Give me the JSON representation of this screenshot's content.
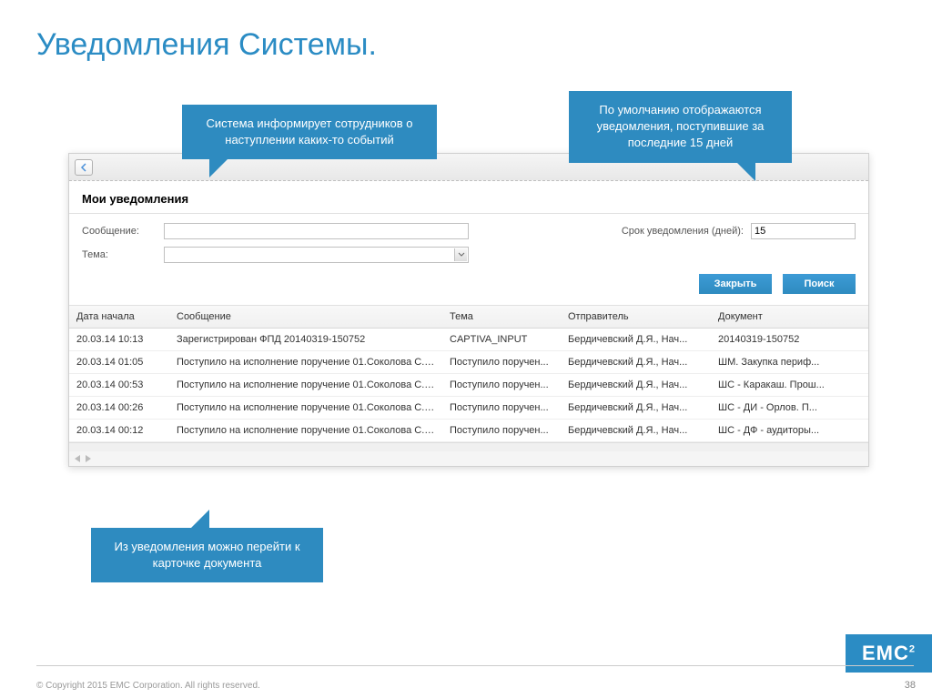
{
  "title": "Уведомления Системы.",
  "callouts": {
    "c1": "Система информирует сотрудников о наступлении каких-то событий",
    "c2": "По умолчанию отображаются уведомления, поступившие за последние 15 дней",
    "c3": "Из уведомления можно перейти к карточке документа"
  },
  "panel": {
    "section_title": "Мои уведомления",
    "filters": {
      "message_label": "Сообщение:",
      "theme_label": "Тема:",
      "period_label": "Срок уведомления (дней):",
      "period_value": "15"
    },
    "buttons": {
      "close": "Закрыть",
      "search": "Поиск"
    },
    "columns": {
      "c1": "Дата начала",
      "c2": "Сообщение",
      "c3": "Тема",
      "c4": "Отправитель",
      "c5": "Документ"
    },
    "rows": [
      {
        "date": "20.03.14 10:13",
        "msg": "Зарегистрирован ФПД 20140319-150752",
        "theme": "CAPTIVA_INPUT",
        "sender": "Бердичевский Д.Я., Нач...",
        "doc": "20140319-150752"
      },
      {
        "date": "20.03.14 01:05",
        "msg": "Поступило на исполнение поручение 01.Соколова С.И....",
        "theme": "Поступило поручен...",
        "sender": "Бердичевский Д.Я., Нач...",
        "doc": "ШМ. Закупка периф..."
      },
      {
        "date": "20.03.14 00:53",
        "msg": "Поступило на исполнение поручение 01.Соколова С.И....",
        "theme": "Поступило поручен...",
        "sender": "Бердичевский Д.Я., Нач...",
        "doc": "ШС - Каракаш. Прош..."
      },
      {
        "date": "20.03.14 00:26",
        "msg": "Поступило на исполнение поручение 01.Соколова С.И....",
        "theme": "Поступило поручен...",
        "sender": "Бердичевский Д.Я., Нач...",
        "doc": "ШС - ДИ - Орлов. П..."
      },
      {
        "date": "20.03.14 00:12",
        "msg": "Поступило на исполнение поручение 01.Соколова С.И....",
        "theme": "Поступило поручен...",
        "sender": "Бердичевский Д.Я., Нач...",
        "doc": "ШС - ДФ - аудиторы..."
      }
    ]
  },
  "footer": {
    "copyright": "© Copyright 2015 EMC Corporation. All rights reserved.",
    "logo": "EMC",
    "logo_sup": "2",
    "page": "38"
  }
}
